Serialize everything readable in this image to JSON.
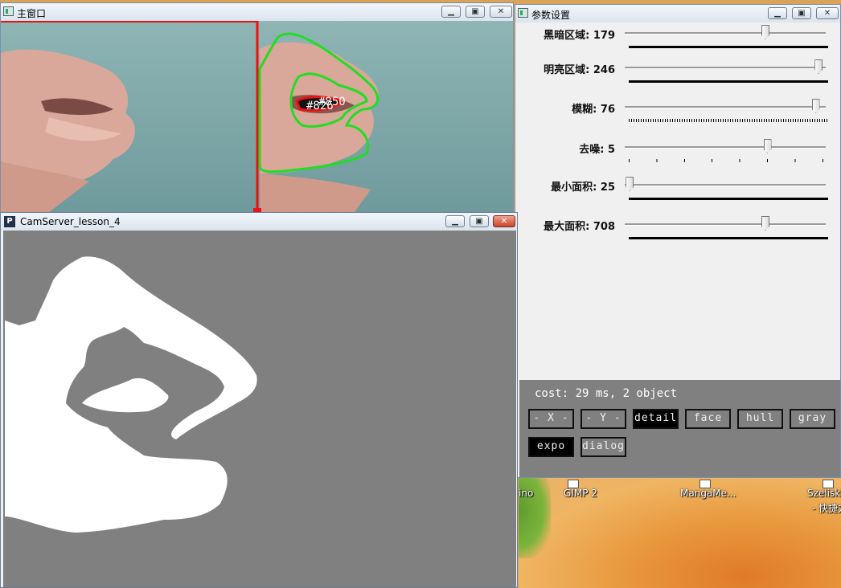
{
  "main_window": {
    "title": "主窗口",
    "labels": [
      "#850",
      "#826"
    ]
  },
  "cam_window": {
    "title": "CamServer_lesson_4",
    "icon_letter": "P"
  },
  "settings_window": {
    "title": "参数设置",
    "trackbars": [
      {
        "label": "黑暗区域: 179",
        "level": 0.7
      },
      {
        "label": "明亮区域: 246",
        "level": 0.965
      },
      {
        "label": "模糊: 76",
        "level": 0.95
      },
      {
        "label": "去噪: 5",
        "level": 0.71
      },
      {
        "label": "最小面积: 25",
        "level": 0.025
      },
      {
        "label": "最大面积: 708",
        "level": 0.7
      }
    ],
    "status": "cost: 29 ms, 2 object",
    "buttons": [
      {
        "label": "- X -",
        "active": false
      },
      {
        "label": "- Y -",
        "active": false
      },
      {
        "label": "detail",
        "active": true
      },
      {
        "label": "face",
        "active": false
      },
      {
        "label": "hull",
        "active": false
      },
      {
        "label": "gray",
        "active": false
      },
      {
        "label": "expo",
        "active": true
      },
      {
        "label": "dialog",
        "active": false
      }
    ]
  },
  "desktop": {
    "icons": [
      "ino",
      "GIMP 2",
      "MangaMe...",
      "Szeliski",
      "- 快捷方"
    ]
  },
  "colors": {
    "contour_green": "#22dd22",
    "contour_red": "#ee1111",
    "panel_gray": "#808080",
    "window_bg": "#f0f0f0"
  }
}
